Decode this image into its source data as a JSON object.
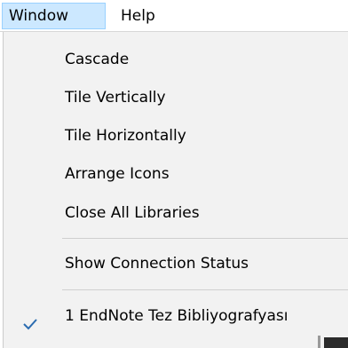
{
  "menubar": {
    "items": [
      {
        "label": "Window",
        "active": true
      },
      {
        "label": "Help",
        "active": false
      }
    ]
  },
  "window_menu": {
    "items": [
      {
        "label": "Cascade"
      },
      {
        "label": "Tile Vertically"
      },
      {
        "label": "Tile Horizontally"
      },
      {
        "label": "Arrange Icons"
      },
      {
        "label": "Close All Libraries"
      },
      {
        "label": "Show Connection Status"
      },
      {
        "label": "1 EndNote Tez Bibliyografyası",
        "checked": true,
        "icon": "checkmark-icon"
      }
    ]
  },
  "colors": {
    "menubar_active_bg": "#cce8ff",
    "menubar_active_border": "#99d1ff",
    "dropdown_bg": "#f2f2f2",
    "checkmark": "#2b6cb0"
  }
}
